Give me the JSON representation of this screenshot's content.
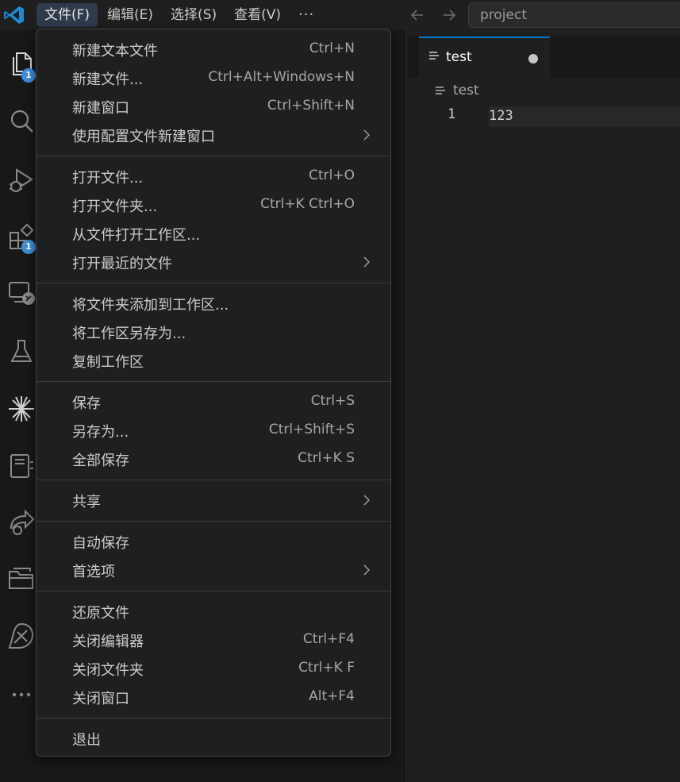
{
  "titlebar": {
    "menus": [
      "文件(F)",
      "编辑(E)",
      "选择(S)",
      "查看(V)"
    ],
    "more": "···",
    "search_text": "project"
  },
  "activity_badges": {
    "explorer": "1",
    "extensions": "1"
  },
  "editor": {
    "tab_label": "test",
    "breadcrumb": "test",
    "line_number": "1",
    "line_text": "123"
  },
  "file_menu": {
    "groups": [
      [
        {
          "label": "新建文本文件",
          "key": "Ctrl+N"
        },
        {
          "label": "新建文件...",
          "key": "Ctrl+Alt+Windows+N"
        },
        {
          "label": "新建窗口",
          "key": "Ctrl+Shift+N"
        },
        {
          "label": "使用配置文件新建窗口",
          "key": "",
          "submenu": true
        }
      ],
      [
        {
          "label": "打开文件...",
          "key": "Ctrl+O"
        },
        {
          "label": "打开文件夹...",
          "key": "Ctrl+K Ctrl+O"
        },
        {
          "label": "从文件打开工作区...",
          "key": ""
        },
        {
          "label": "打开最近的文件",
          "key": "",
          "submenu": true
        }
      ],
      [
        {
          "label": "将文件夹添加到工作区...",
          "key": ""
        },
        {
          "label": "将工作区另存为...",
          "key": ""
        },
        {
          "label": "复制工作区",
          "key": ""
        }
      ],
      [
        {
          "label": "保存",
          "key": "Ctrl+S"
        },
        {
          "label": "另存为...",
          "key": "Ctrl+Shift+S"
        },
        {
          "label": "全部保存",
          "key": "Ctrl+K S"
        }
      ],
      [
        {
          "label": "共享",
          "key": "",
          "submenu": true
        }
      ],
      [
        {
          "label": "自动保存",
          "key": ""
        },
        {
          "label": "首选项",
          "key": "",
          "submenu": true
        }
      ],
      [
        {
          "label": "还原文件",
          "key": ""
        },
        {
          "label": "关闭编辑器",
          "key": "Ctrl+F4"
        },
        {
          "label": "关闭文件夹",
          "key": "Ctrl+K F"
        },
        {
          "label": "关闭窗口",
          "key": "Alt+F4"
        }
      ],
      [
        {
          "label": "退出",
          "key": ""
        }
      ]
    ]
  },
  "colors": {
    "accent": "#0078d4",
    "badge": "#3c8fdc",
    "menu_bg": "#1f1f1f",
    "active_menu_bg": "#2f3b4c"
  }
}
